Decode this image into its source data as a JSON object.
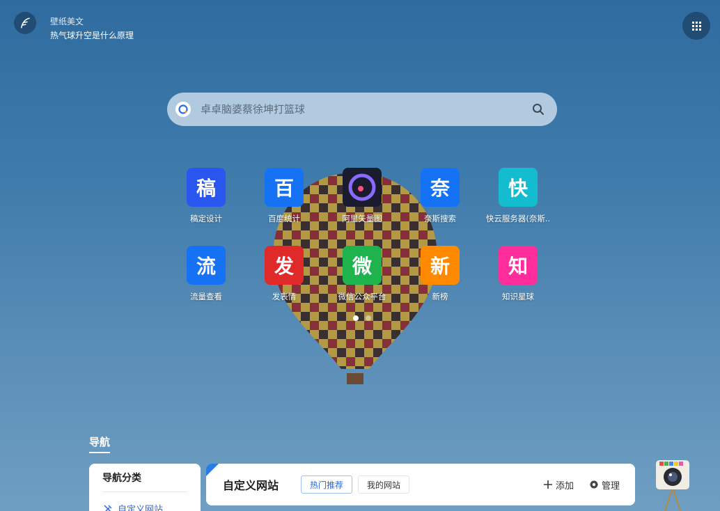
{
  "header": {
    "wallpaper_title": "壁纸美文",
    "wallpaper_subtitle": "热气球升空是什么原理"
  },
  "search": {
    "placeholder": "卓卓脑婆蔡徐坤打篮球"
  },
  "shortcuts": [
    {
      "label": "稿定设计",
      "glyph": "稿",
      "color": "#2a56f0"
    },
    {
      "label": "百度统计",
      "glyph": "百",
      "color": "#1672f5"
    },
    {
      "label": "阿里矢量图",
      "glyph": "",
      "color": "#1b1b2e"
    },
    {
      "label": "奈斯搜索",
      "glyph": "奈",
      "color": "#1672f5"
    },
    {
      "label": "快云服务器(奈斯..",
      "glyph": "快",
      "color": "#13bccf"
    },
    {
      "label": "流量查看",
      "glyph": "流",
      "color": "#1672f5"
    },
    {
      "label": "发表情",
      "glyph": "发",
      "color": "#e02a2a"
    },
    {
      "label": "微信公众平台",
      "glyph": "微",
      "color": "#1fb34e"
    },
    {
      "label": "新榜",
      "glyph": "新",
      "color": "#ff8a00"
    },
    {
      "label": "知识星球",
      "glyph": "知",
      "color": "#ff2d9b"
    }
  ],
  "pagination": {
    "current": 1,
    "total": 2
  },
  "nav": {
    "tab_label": "导航",
    "category_title": "导航分类",
    "category_item": "自定义网站",
    "site_title": "自定义网站",
    "chip_hot": "热门推荐",
    "chip_mine": "我的网站",
    "add_label": "添加",
    "manage_label": "管理"
  }
}
